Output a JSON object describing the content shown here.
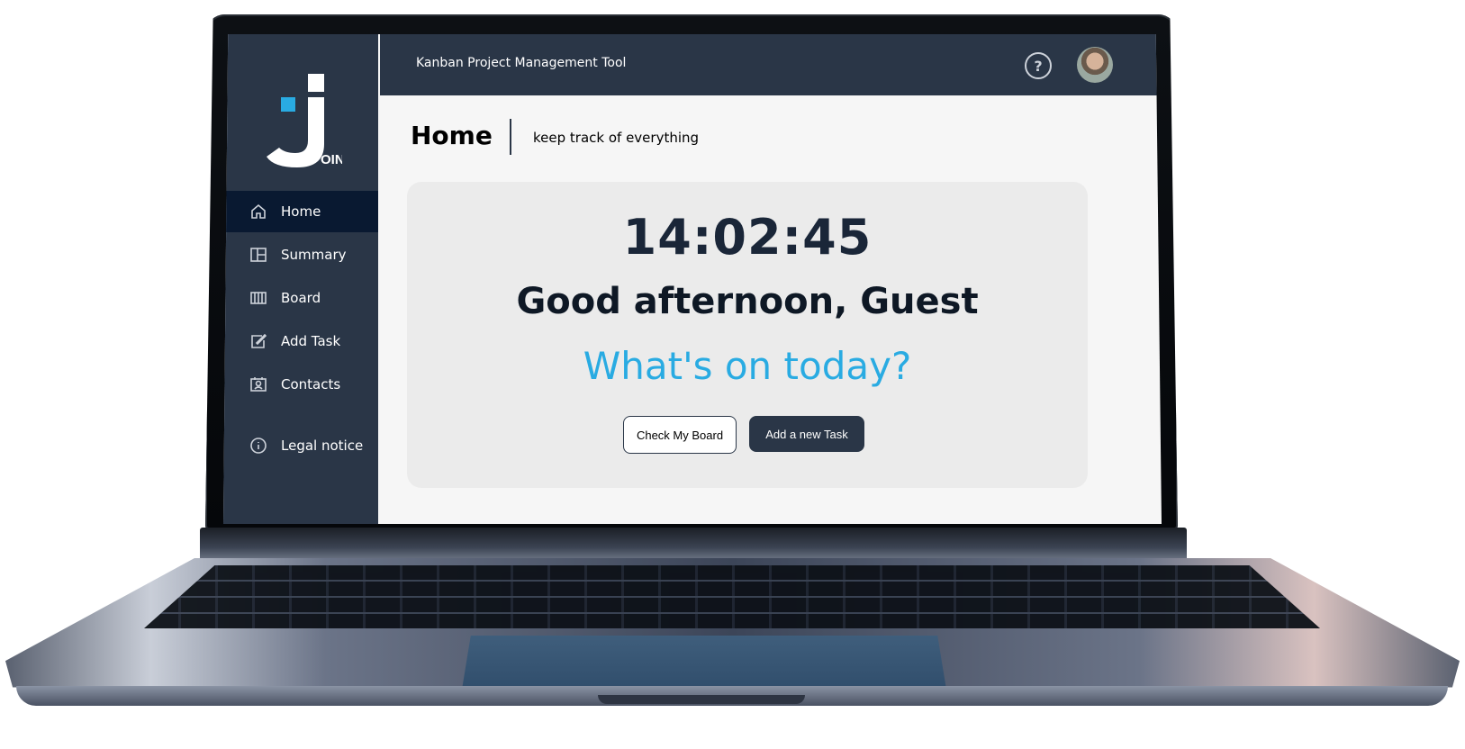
{
  "header": {
    "title": "Kanban Project Management Tool",
    "help_label": "?"
  },
  "logo": {
    "letters": "OIN"
  },
  "sidebar": {
    "items": [
      {
        "label": "Home",
        "icon": "home-icon",
        "active": true
      },
      {
        "label": "Summary",
        "icon": "summary-icon"
      },
      {
        "label": "Board",
        "icon": "board-icon"
      },
      {
        "label": "Add Task",
        "icon": "edit-icon"
      },
      {
        "label": "Contacts",
        "icon": "contacts-icon"
      }
    ],
    "legal": {
      "label": "Legal notice",
      "icon": "info-icon"
    }
  },
  "page": {
    "title": "Home",
    "subtitle": "keep track of everything"
  },
  "hero": {
    "clock": "14:02:45",
    "greeting": "Good afternoon, Guest",
    "question": "What's on today?",
    "check_board_label": "Check My Board",
    "add_task_label": "Add a new Task"
  },
  "colors": {
    "primary": "#2a3647",
    "active_nav": "#091931",
    "accent": "#29abe2",
    "background": "#f6f6f6",
    "card": "#ebebeb"
  }
}
